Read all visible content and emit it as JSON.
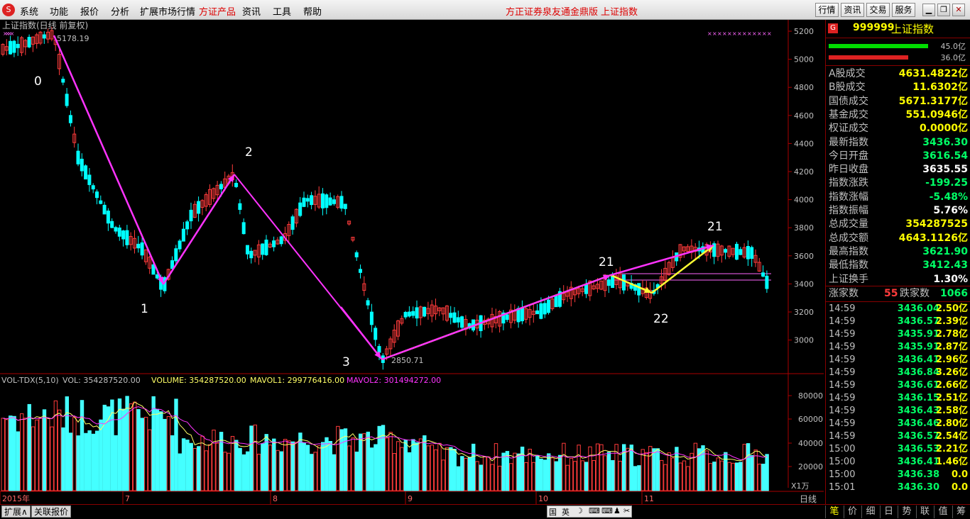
{
  "menu": {
    "items": [
      "系统",
      "功能",
      "报价",
      "分析",
      "扩展市场行情",
      "方证产品",
      "资讯",
      "工具",
      "帮助"
    ],
    "center_title": "方正证券泉友通金鼎版",
    "center_index": "上证指数",
    "buttons": [
      "行情",
      "资讯",
      "交易",
      "服务"
    ]
  },
  "chart": {
    "title": "上证指数(日线 前复权)",
    "high_label": "5178.19",
    "low_label": "2850.71",
    "y_axis": [
      "5200",
      "5000",
      "4800",
      "4600",
      "4400",
      "4200",
      "4000",
      "3800",
      "3600",
      "3400",
      "3200",
      "3000"
    ],
    "x_axis": [
      "2015年",
      "7",
      "8",
      "9",
      "10",
      "11"
    ],
    "wave_labels": [
      "0",
      "1",
      "2",
      "3",
      "21",
      "22",
      "21"
    ],
    "vol_header": {
      "name": "VOL-TDX(5,10)",
      "vol": "VOL: 354287520.00",
      "volume": "VOLUME: 354287520.00",
      "mavol1": "MAVOL1: 299776416.00",
      "mavol2": "MAVOL2: 301494272.00"
    },
    "vol_axis": [
      "80000",
      "60000",
      "40000",
      "20000"
    ],
    "vol_unit": "X1万",
    "period": "日线",
    "colors": {
      "up": "#ff3b3b",
      "down": "#00ffff",
      "wave": "#ff33ff",
      "wave2": "#ffff33"
    }
  },
  "panel": {
    "code": "999999",
    "name": "上证指数",
    "bar1": "45.0亿",
    "bar2": "36.0亿",
    "rows": [
      {
        "label": "A股成交",
        "value": "4631.4822亿",
        "color": "#ffff00"
      },
      {
        "label": "B股成交",
        "value": "11.6302亿",
        "color": "#ffff00"
      },
      {
        "label": "国债成交",
        "value": "5671.3177亿",
        "color": "#ffff00"
      },
      {
        "label": "基金成交",
        "value": "551.0946亿",
        "color": "#ffff00"
      },
      {
        "label": "权证成交",
        "value": "0.0000亿",
        "color": "#ffff00"
      },
      {
        "label": "最新指数",
        "value": "3436.30",
        "color": "#00ff66"
      },
      {
        "label": "今日开盘",
        "value": "3616.54",
        "color": "#00ff66"
      },
      {
        "label": "昨日收盘",
        "value": "3635.55",
        "color": "#ffffff"
      },
      {
        "label": "指数涨跌",
        "value": "-199.25",
        "color": "#00ff66"
      },
      {
        "label": "指数涨幅",
        "value": "-5.48%",
        "color": "#00ff66"
      },
      {
        "label": "指数振幅",
        "value": "5.76%",
        "color": "#ffffff"
      },
      {
        "label": "总成交量",
        "value": "354287525",
        "color": "#ffff00"
      },
      {
        "label": "总成交额",
        "value": "4643.1126亿",
        "color": "#ffff00"
      },
      {
        "label": "最高指数",
        "value": "3621.90",
        "color": "#00ff66"
      },
      {
        "label": "最低指数",
        "value": "3412.43",
        "color": "#00ff66"
      },
      {
        "label": "上证换手",
        "value": "1.30%",
        "color": "#ffffff"
      }
    ],
    "up_label": "涨家数",
    "up_count": "55",
    "down_label": "跌家数",
    "down_count": "1066",
    "ticks": [
      {
        "t": "14:59",
        "p": "3436.04",
        "q": "2.50亿"
      },
      {
        "t": "14:59",
        "p": "3436.57",
        "q": "2.39亿"
      },
      {
        "t": "14:59",
        "p": "3435.91",
        "q": "2.78亿"
      },
      {
        "t": "14:59",
        "p": "3435.91",
        "q": "2.87亿"
      },
      {
        "t": "14:59",
        "p": "3436.41",
        "q": "2.96亿"
      },
      {
        "t": "14:59",
        "p": "3436.84",
        "q": "3.26亿"
      },
      {
        "t": "14:59",
        "p": "3436.61",
        "q": "2.66亿"
      },
      {
        "t": "14:59",
        "p": "3436.15",
        "q": "2.51亿"
      },
      {
        "t": "14:59",
        "p": "3436.43",
        "q": "2.58亿"
      },
      {
        "t": "14:59",
        "p": "3436.46",
        "q": "2.80亿"
      },
      {
        "t": "14:59",
        "p": "3436.57",
        "q": "2.54亿"
      },
      {
        "t": "15:00",
        "p": "3436.53",
        "q": "2.21亿"
      },
      {
        "t": "15:00",
        "p": "3436.41",
        "q": "1.46亿"
      },
      {
        "t": "15:00",
        "p": "3436.38",
        "q": "0.0"
      },
      {
        "t": "15:01",
        "p": "3436.30",
        "q": "0.0"
      }
    ]
  },
  "bottom": {
    "tabs": [
      "扩展∧",
      "关联报价"
    ],
    "ime": [
      "国",
      "英",
      "☽",
      "⌨",
      "⌨",
      "♟",
      "✂"
    ],
    "right_tabs": [
      "笔",
      "价",
      "细",
      "日",
      "势",
      "联",
      "值",
      "筹"
    ]
  }
}
